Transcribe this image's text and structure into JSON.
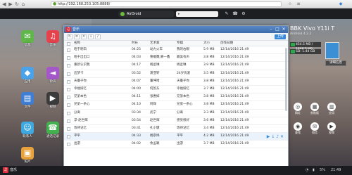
{
  "browser": {
    "url": "http://192.168.253.105:8888/",
    "back": "◀",
    "forward": "▶",
    "reload": "↻",
    "home": "⌂"
  },
  "topbar": {
    "logo_text": "AirDroid",
    "search_text": "▸"
  },
  "desktop_icons": [
    {
      "label": "信息",
      "color": "#5fb649",
      "glyph": "✉"
    },
    {
      "label": "音乐",
      "color": "#e4434d",
      "glyph": "♫"
    },
    {
      "label": "应用",
      "color": "#4aa3e8",
      "glyph": "◆"
    },
    {
      "label": "铃声",
      "color": "#a457c9",
      "glyph": "◄"
    },
    {
      "label": "文件",
      "color": "#3e7fd5",
      "glyph": "▤"
    },
    {
      "label": "视频",
      "color": "#3b3b3b",
      "glyph": "▶"
    },
    {
      "label": "联系人",
      "color": "#3ea8e0",
      "glyph": "☺"
    },
    {
      "label": "通话记录",
      "color": "#45b050",
      "glyph": "☎"
    },
    {
      "label": "照片",
      "color": "#e9a23b",
      "glyph": "▣"
    }
  ],
  "window": {
    "title": "音乐",
    "upload_label": "上传",
    "columns": [
      "名称",
      "时长",
      "艺术家",
      "专辑",
      "大小",
      "创作日期"
    ],
    "rows": [
      {
        "name": "咱于明白",
        "dur": "04:25",
        "artist": "动力火车",
        "album": "我的右眼",
        "size": "5.9 MB",
        "date": "12/14/2016 21:49"
      },
      {
        "name": "咱于出出口",
        "dur": "04:03",
        "artist": "寮敢魏,寮一鑫",
        "album": "最美有声",
        "size": "3.8 MB",
        "date": "12/14/2016 21:49"
      },
      {
        "name": "重新认识我",
        "dur": "04:17",
        "artist": "杨丞琳",
        "album": "杨丞琳",
        "size": "3.9 MB",
        "date": "12/14/2016 21:49"
      },
      {
        "name": "这梦卡",
        "dur": "03:52",
        "artist": "萧亚轩",
        "album": "24岁优爱",
        "size": "3.5 MB",
        "date": "12/14/2016 21:49"
      },
      {
        "name": "天臺子你",
        "dur": "04:07",
        "artist": "董坤哈",
        "album": "天臺子你",
        "size": "3.8 MB",
        "date": "12/14/2016 21:49"
      },
      {
        "name": "幸福排忆",
        "dur": "04:00",
        "artist": "何韵东",
        "album": "幸福排忆",
        "size": "3.7 MB",
        "date": "12/14/2016 21:49"
      },
      {
        "name": "兄弟本色",
        "dur": "04:11",
        "artist": "张惠妹",
        "album": "兄弟本色",
        "size": "3.8 MB",
        "date": "12/14/2016 21:49"
      },
      {
        "name": "兄弟一条心",
        "dur": "04:10",
        "artist": "阿辉",
        "album": "兄弟一条心",
        "size": "3.8 MB",
        "date": "12/14/2016 21:49"
      },
      {
        "name": "分离",
        "dur": "03:34",
        "artist": "武宁",
        "album": "分离",
        "size": "3.3 MB",
        "date": "12/14/2016 21:49"
      },
      {
        "name": "浮-赵世辉",
        "dur": "03:54",
        "artist": "赵世辉",
        "album": "感觉很好",
        "size": "3.6 MB",
        "date": "12/14/2016 21:49"
      },
      {
        "name": "等待记忆",
        "dur": "03:41",
        "artist": "孔小健",
        "album": "等待记忆",
        "size": "3.4 MB",
        "date": "12/14/2016 21:49"
      },
      {
        "name": "平平",
        "dur": "04:33",
        "artist": "杨宗纬",
        "album": "平平",
        "size": "4.2 MB",
        "date": "12/14/2016 21:49"
      },
      {
        "name": "出游",
        "dur": "04:02",
        "artist": "余孟颖",
        "album": "出游",
        "size": "3.7 MB",
        "date": "12/14/2016 21:49"
      }
    ]
  },
  "device": {
    "name": "BBK Vivo Y11i T",
    "android": "Android 4.2.2",
    "storage_internal": "454.5 MB / 1888.5 MB",
    "storage_sd": "SD: 1.44 GB",
    "detail_label": "详细信息"
  },
  "tools": [
    {
      "label": "网址",
      "glyph": "◎"
    },
    {
      "label": "剪贴板",
      "glyph": "▦"
    },
    {
      "label": "应用",
      "glyph": "▥"
    },
    {
      "label": "查找",
      "glyph": "◉"
    },
    {
      "label": "短信",
      "glyph": "✉"
    },
    {
      "label": "视频",
      "glyph": "▶"
    }
  ],
  "taskbar": {
    "app_label": "音乐",
    "battery": "5%",
    "time": "21:49"
  },
  "watermark": "jingyan.baidu.com"
}
